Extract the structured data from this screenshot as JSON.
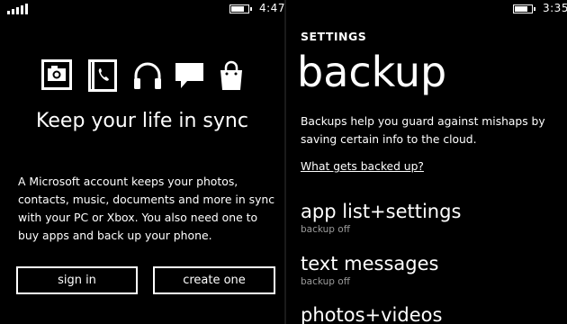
{
  "left_screen": {
    "status_bar": {
      "time": "4:47",
      "battery_level": 0.85
    },
    "icons": [
      "camera-icon",
      "phone-book-icon",
      "headphones-icon",
      "message-icon",
      "shopping-bag-icon"
    ],
    "title": "Keep your life in sync",
    "body": "A Microsoft account keeps your photos, contacts, music, documents and more in sync with your PC or Xbox. You also need one to buy apps and back up your phone.",
    "buttons": {
      "sign_in": "sign in",
      "create_one": "create one"
    }
  },
  "right_screen": {
    "status_bar": {
      "time": "3:35",
      "battery_level": 0.85
    },
    "section": "SETTINGS",
    "title": "backup",
    "description": "Backups help you guard against mishaps by saving certain info to the cloud.",
    "link": "What gets backed up?",
    "items": [
      {
        "label": "app list+settings",
        "status": "backup off"
      },
      {
        "label": "text messages",
        "status": "backup off"
      },
      {
        "label": "photos+videos",
        "status": ""
      }
    ]
  },
  "colors": {
    "background": "#000000",
    "foreground": "#ffffff",
    "subtle": "#9a9a9a"
  }
}
